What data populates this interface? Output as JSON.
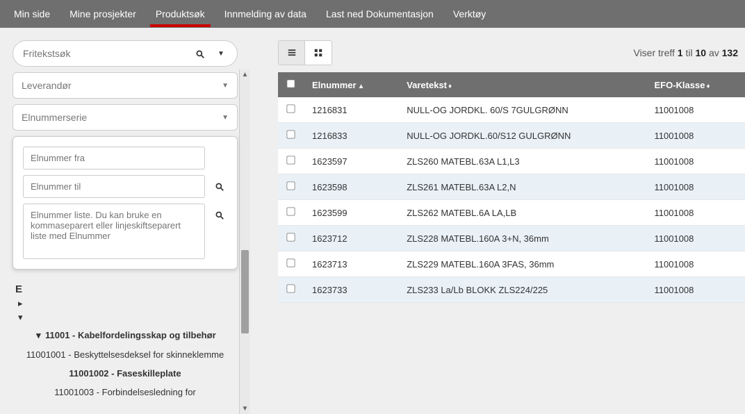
{
  "nav": {
    "items": [
      "Min side",
      "Mine prosjekter",
      "Produktsøk",
      "Innmelding av data",
      "Last ned Dokumentasjon",
      "Verktøy"
    ],
    "active_index": 2
  },
  "search": {
    "freetext_placeholder": "Fritekstsøk",
    "supplier_placeholder": "Leverandør",
    "elnumber_series_placeholder": "Elnummerserie",
    "from_placeholder": "Elnummer fra",
    "to_placeholder": "Elnummer til",
    "list_placeholder": "Elnummer liste. Du kan bruke en kommaseparert eller linjeskiftseparert liste med Elnummer"
  },
  "tree": {
    "parent": "11001 - Kabelfordelingsskap og tilbehør",
    "children": [
      "11001001 - Beskyttelsesdeksel for skinneklemme",
      "11001002 - Faseskilleplate",
      "11001003 - Forbindelsesledning for"
    ],
    "expanded_bold_index": 1,
    "letter_marker": "E"
  },
  "results": {
    "text_prefix": "Viser treff",
    "from": "1",
    "to_label": "til",
    "to": "10",
    "of_label": "av",
    "total": "132"
  },
  "table": {
    "headers": {
      "elnummer": "Elnummer",
      "varetekst": "Varetekst",
      "efo": "EFO-Klasse"
    },
    "sort": {
      "col": "elnummer",
      "dir": "asc"
    },
    "rows": [
      {
        "elnummer": "1216831",
        "varetekst": "NULL-OG JORDKL. 60/S 7GULGRØNN",
        "efo": "11001008"
      },
      {
        "elnummer": "1216833",
        "varetekst": "NULL-OG JORDKL.60/S12 GULGRØNN",
        "efo": "11001008"
      },
      {
        "elnummer": "1623597",
        "varetekst": "ZLS260 MATEBL.63A L1,L3",
        "efo": "11001008"
      },
      {
        "elnummer": "1623598",
        "varetekst": "ZLS261 MATEBL.63A L2,N",
        "efo": "11001008"
      },
      {
        "elnummer": "1623599",
        "varetekst": "ZLS262 MATEBL.6A LA,LB",
        "efo": "11001008"
      },
      {
        "elnummer": "1623712",
        "varetekst": "ZLS228 MATEBL.160A 3+N, 36mm",
        "efo": "11001008"
      },
      {
        "elnummer": "1623713",
        "varetekst": "ZLS229 MATEBL.160A 3FAS, 36mm",
        "efo": "11001008"
      },
      {
        "elnummer": "1623733",
        "varetekst": "ZLS233 La/Lb BLOKK ZLS224/225",
        "efo": "11001008"
      }
    ]
  },
  "colors": {
    "nav_bg": "#6f6f6f",
    "active_underline": "#c00",
    "row_even": "#e9f1f7"
  }
}
